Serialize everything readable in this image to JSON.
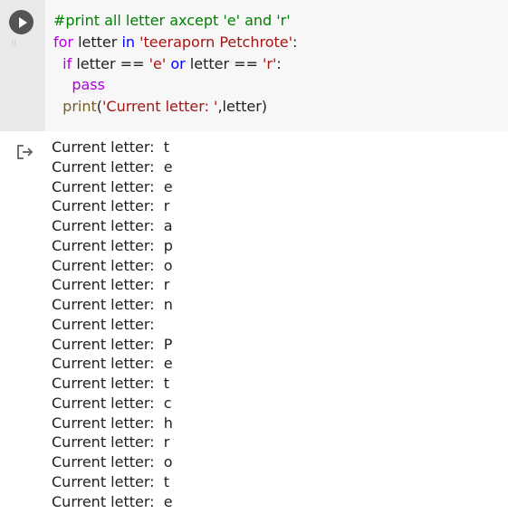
{
  "code_cell": {
    "run_icon": "play-circle-icon",
    "lines": [
      {
        "parts": [
          {
            "t": "#print all letter axcept 'e' and 'r'",
            "c": "c-comment"
          }
        ]
      },
      {
        "parts": [
          {
            "t": "for",
            "c": "c-kw"
          },
          {
            "t": " letter ",
            "c": ""
          },
          {
            "t": "in",
            "c": "c-op"
          },
          {
            "t": " ",
            "c": ""
          },
          {
            "t": "'teeraporn Petchrote'",
            "c": "c-str"
          },
          {
            "t": ":",
            "c": ""
          }
        ]
      },
      {
        "parts": [
          {
            "t": "  ",
            "c": ""
          },
          {
            "t": "if",
            "c": "c-kw"
          },
          {
            "t": " letter == ",
            "c": ""
          },
          {
            "t": "'e'",
            "c": "c-str"
          },
          {
            "t": " ",
            "c": ""
          },
          {
            "t": "or",
            "c": "c-op"
          },
          {
            "t": " letter == ",
            "c": ""
          },
          {
            "t": "'r'",
            "c": "c-str"
          },
          {
            "t": ":",
            "c": ""
          }
        ]
      },
      {
        "parts": [
          {
            "t": "    ",
            "c": ""
          },
          {
            "t": "pass",
            "c": "c-kw"
          }
        ]
      },
      {
        "parts": [
          {
            "t": "  ",
            "c": ""
          },
          {
            "t": "print",
            "c": "c-func"
          },
          {
            "t": "(",
            "c": ""
          },
          {
            "t": "'Current letter: '",
            "c": "c-str"
          },
          {
            "t": ",letter)",
            "c": ""
          }
        ]
      }
    ]
  },
  "output": {
    "icon": "output-arrow-icon",
    "prefix": "Current letter:  ",
    "letters": [
      "t",
      "e",
      "e",
      "r",
      "a",
      "p",
      "o",
      "r",
      "n",
      "",
      "P",
      "e",
      "t",
      "c",
      "h",
      "r",
      "o",
      "t",
      "e"
    ]
  },
  "colors": {
    "comment": "#008000",
    "keyword": "#af00db",
    "string": "#a31515",
    "function": "#795e26",
    "operator": "#0000ff"
  }
}
